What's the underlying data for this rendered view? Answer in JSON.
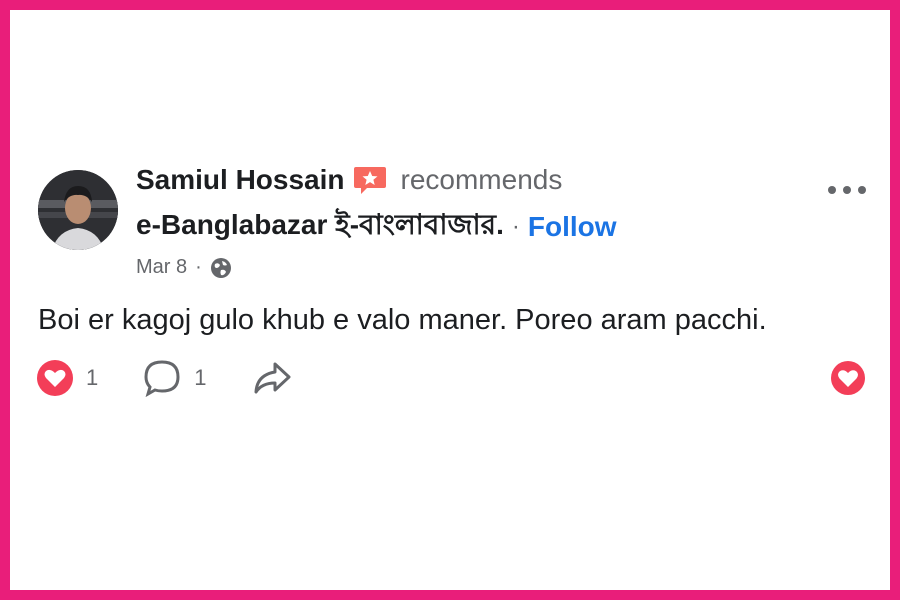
{
  "post": {
    "author": "Samiul Hossain",
    "verb": "recommends",
    "page_name": "e-Banglabazar ই-বাংলাবাজার.",
    "separator": "·",
    "follow_label": "Follow",
    "date": "Mar 8",
    "meta_separator": "·",
    "audience_icon": "globe-icon",
    "text": "Boi er kagoj gulo khub e valo maner. Poreo aram pacchi."
  },
  "actions": {
    "reactions_count": "1",
    "comments_count": "1",
    "reactions_icon": "heart-reaction-icon",
    "comment_icon": "comment-icon",
    "share_icon": "share-icon"
  },
  "colors": {
    "frame": "#e91e7a",
    "link": "#1b74e4",
    "heart": "#f33e58",
    "secondary_text": "#65676b"
  }
}
